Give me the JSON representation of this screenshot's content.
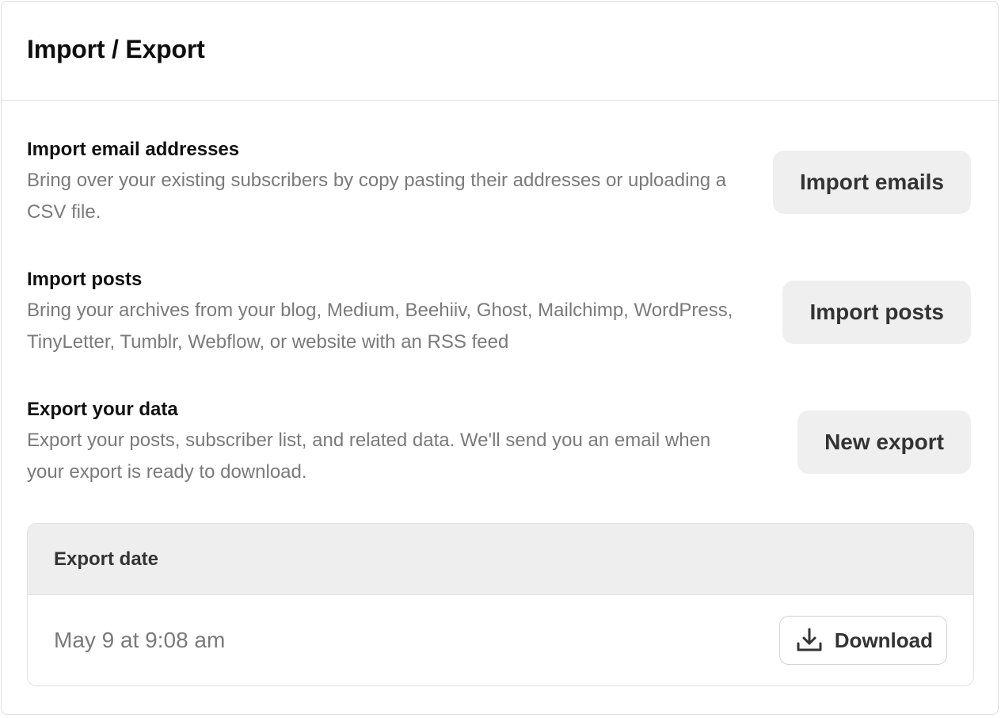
{
  "header": {
    "title": "Import / Export"
  },
  "sections": [
    {
      "title": "Import email addresses",
      "description": "Bring over your existing subscribers by copy pasting their addresses or uploading a CSV file.",
      "button_label": "Import emails"
    },
    {
      "title": "Import posts",
      "description": "Bring your archives from your blog, Medium, Beehiiv, Ghost, Mailchimp, WordPress, TinyLetter, Tumblr, Webflow, or website with an RSS feed",
      "button_label": "Import posts"
    },
    {
      "title": "Export your data",
      "description": "Export your posts, subscriber list, and related data. We'll send you an email when your export is ready to download.",
      "button_label": "New export"
    }
  ],
  "exports_table": {
    "column_header": "Export date",
    "rows": [
      {
        "date": "May 9 at 9:08 am",
        "action_label": "Download",
        "action_icon": "download-icon"
      }
    ]
  },
  "colors": {
    "button_bg": "#efefef",
    "muted_text": "#7a7a7a",
    "table_header_bg": "#eeeeee"
  }
}
